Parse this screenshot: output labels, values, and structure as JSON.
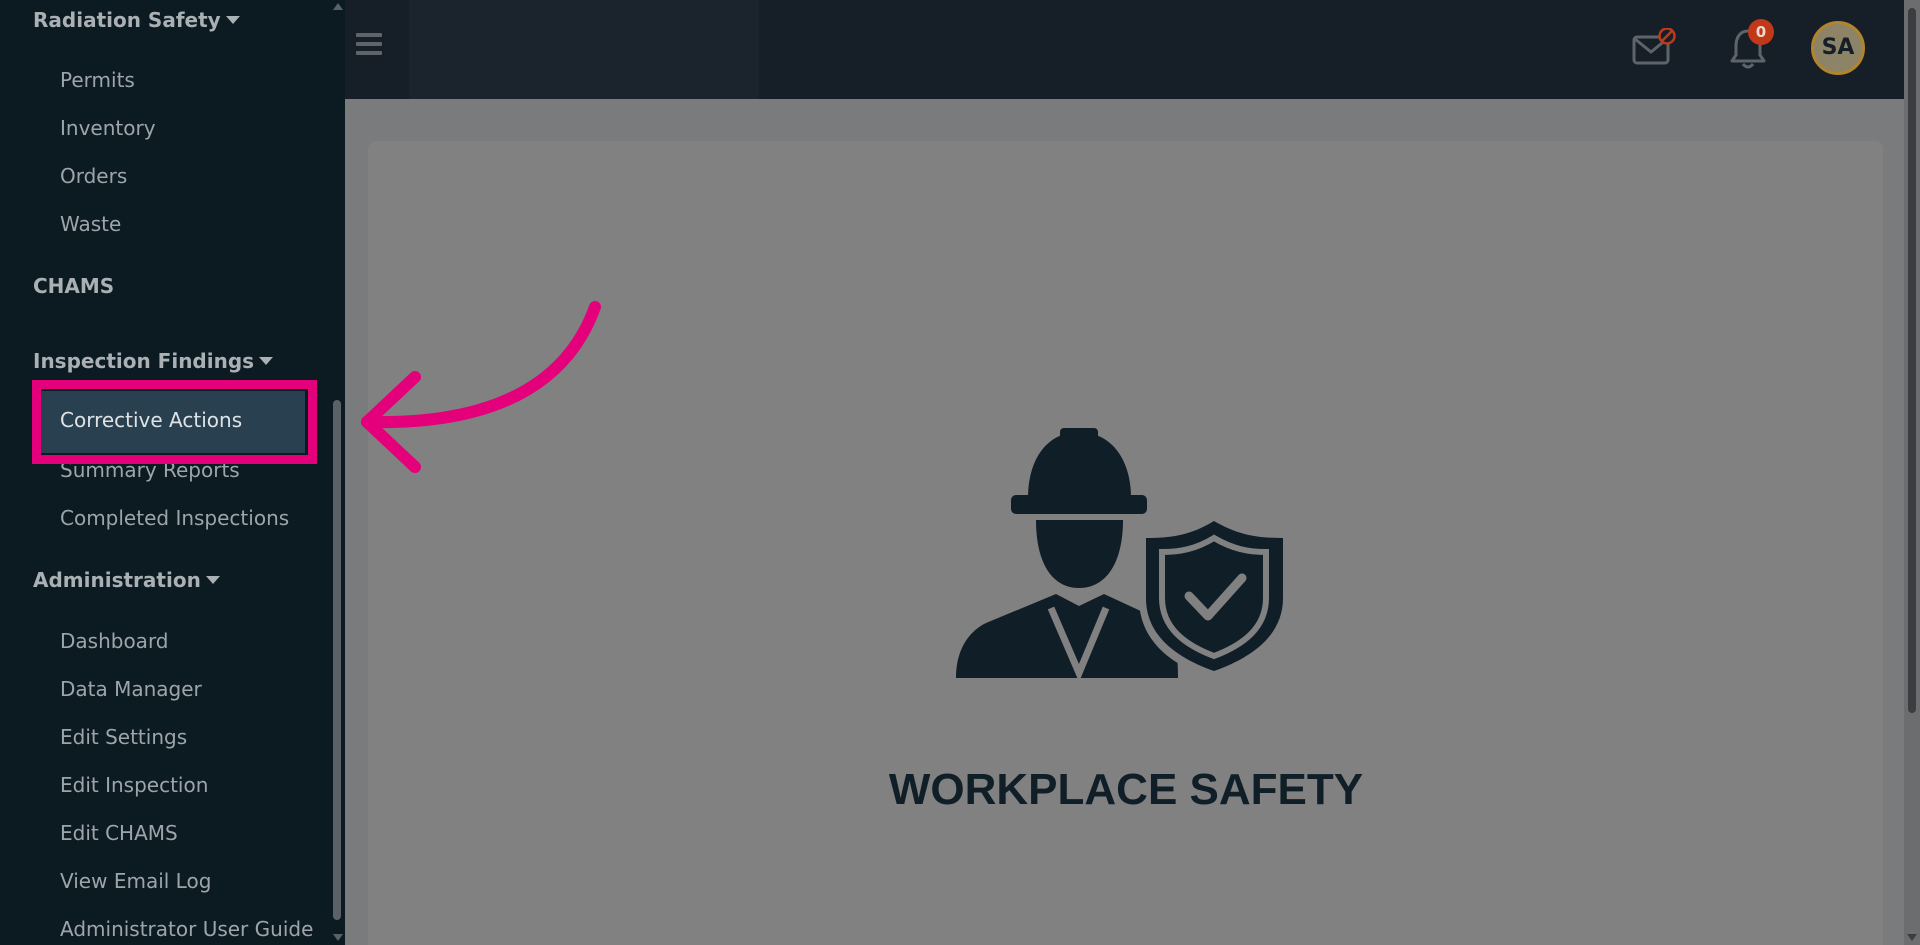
{
  "sidebar": {
    "radiation_safety": "Radiation Safety",
    "radiation_items": [
      "Permits",
      "Inventory",
      "Orders",
      "Waste"
    ],
    "chams": "CHAMS",
    "inspection_findings": "Inspection Findings",
    "inspection_items": [
      "Corrective Actions",
      "Summary Reports",
      "Completed Inspections"
    ],
    "administration": "Administration",
    "admin_items": [
      "Dashboard",
      "Data Manager",
      "Edit Settings",
      "Edit Inspection",
      "Edit CHAMS",
      "View Email Log",
      "Administrator User Guide"
    ]
  },
  "topbar": {
    "notification_count": "0",
    "avatar_initials": "SA"
  },
  "content": {
    "title": "WORKPLACE SAFETY"
  },
  "icons": {
    "menu": "hamburger-menu-icon",
    "mail": "mail-blocked-icon",
    "bell": "bell-icon",
    "illustration": "worker-shield-icon"
  },
  "colors": {
    "sidebar_bg": "#0c1a22",
    "active_item_bg": "#294050",
    "topbar_bg": "#161f27",
    "annotation": "#e3007a",
    "badge": "#c2391a"
  }
}
